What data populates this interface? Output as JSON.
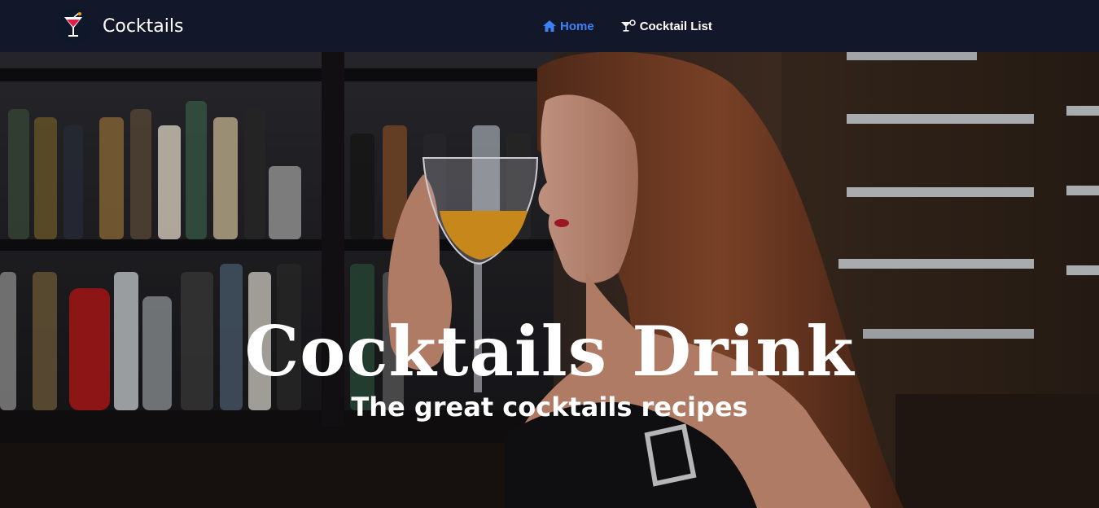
{
  "navbar": {
    "brand": "Cocktails",
    "logo_icon": "cocktail-glass-icon",
    "links": [
      {
        "label": "Home",
        "icon": "home-icon",
        "active": true
      },
      {
        "label": "Cocktail List",
        "icon": "cocktail-icon",
        "active": false
      }
    ],
    "active_color": "#3b82f6",
    "background": "#121829"
  },
  "hero": {
    "title": "Cocktails Drink",
    "subtitle": "The great cocktails recipes",
    "image": "woman-drinking-cocktail-at-bar-photo"
  }
}
